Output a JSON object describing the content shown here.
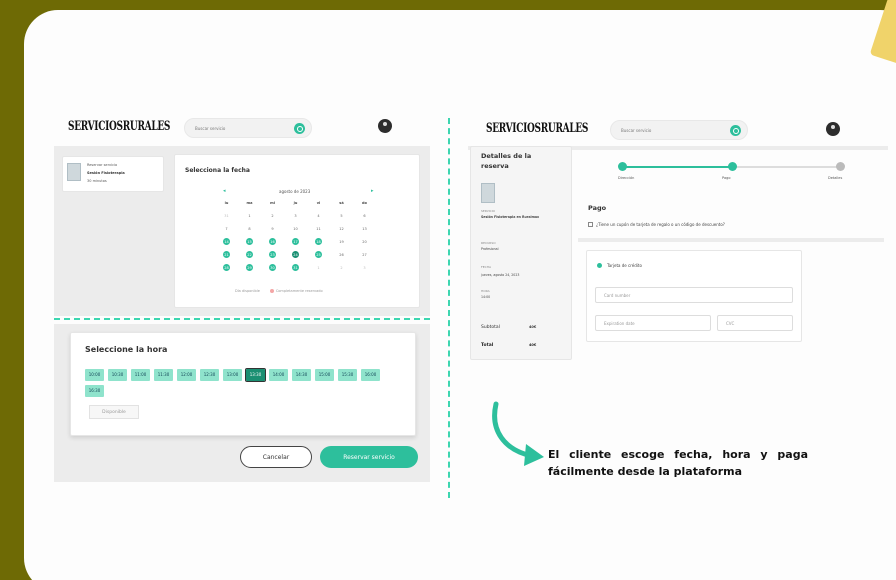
{
  "brand": {
    "logo": "SERVICIOSRURALES"
  },
  "search": {
    "placeholder": "Buscar servicio"
  },
  "colors": {
    "accent": "#2dbf9c",
    "accent_dark": "#1a8f72",
    "background": "#6e6a05"
  },
  "left": {
    "service_card": {
      "label": "Reservar servicio",
      "name": "Sesión Fisioterapia",
      "duration": "30 minutos"
    },
    "calendar": {
      "title": "Selecciona la fecha",
      "month": "agosto de 2023",
      "weekdays": [
        "lu",
        "ma",
        "mi",
        "ju",
        "vi",
        "sá",
        "do"
      ],
      "days": [
        {
          "d": "31",
          "s": "dim"
        },
        {
          "d": "1",
          "s": ""
        },
        {
          "d": "2",
          "s": ""
        },
        {
          "d": "3",
          "s": ""
        },
        {
          "d": "4",
          "s": ""
        },
        {
          "d": "5",
          "s": ""
        },
        {
          "d": "6",
          "s": ""
        },
        {
          "d": "7",
          "s": ""
        },
        {
          "d": "8",
          "s": ""
        },
        {
          "d": "9",
          "s": ""
        },
        {
          "d": "10",
          "s": ""
        },
        {
          "d": "11",
          "s": ""
        },
        {
          "d": "12",
          "s": ""
        },
        {
          "d": "13",
          "s": ""
        },
        {
          "d": "14",
          "s": "av"
        },
        {
          "d": "15",
          "s": "av"
        },
        {
          "d": "16",
          "s": "av"
        },
        {
          "d": "17",
          "s": "av"
        },
        {
          "d": "18",
          "s": "av"
        },
        {
          "d": "19",
          "s": ""
        },
        {
          "d": "20",
          "s": ""
        },
        {
          "d": "21",
          "s": "av"
        },
        {
          "d": "22",
          "s": "av"
        },
        {
          "d": "23",
          "s": "av"
        },
        {
          "d": "24",
          "s": "av sel"
        },
        {
          "d": "25",
          "s": "av"
        },
        {
          "d": "26",
          "s": ""
        },
        {
          "d": "27",
          "s": ""
        },
        {
          "d": "28",
          "s": "av"
        },
        {
          "d": "29",
          "s": "av"
        },
        {
          "d": "30",
          "s": "av"
        },
        {
          "d": "31",
          "s": "av"
        },
        {
          "d": "1",
          "s": "dim"
        },
        {
          "d": "2",
          "s": "dim"
        },
        {
          "d": "3",
          "s": "dim"
        }
      ],
      "legend_available": "Día disponible",
      "legend_full": "Completamente reservado"
    },
    "hours": {
      "title": "Seleccione la hora",
      "slots": [
        "10:00",
        "10:30",
        "11:00",
        "11:30",
        "12:00",
        "12:30",
        "13:00",
        "13:30",
        "14:00",
        "14:30",
        "15:00",
        "15:30",
        "16:00",
        "16:30"
      ],
      "selected": "13:30",
      "legend": "Disponible"
    },
    "buttons": {
      "cancel": "Cancelar",
      "reserve": "Reservar servicio"
    }
  },
  "right": {
    "details": {
      "title": "Detalles de la reserva",
      "service_label": "SERVICIO",
      "service_value": "Sesión Fisioterapia en Ruralmax",
      "resource_label": "RECURSO",
      "resource_value": "Profesional",
      "date_label": "FECHA",
      "date_value": "jueves, agosto 24, 2023",
      "time_label": "HORA",
      "time_value": "14:00",
      "subtotal_label": "Subtotal",
      "subtotal_value": "40€",
      "total_label": "Total",
      "total_value": "40€"
    },
    "steps": [
      "Dirección",
      "Pago",
      "Detalles"
    ],
    "payment": {
      "title": "Pago",
      "coupon": "¿Tiene un cupón de tarjeta de regalo o un código de descuento?",
      "method": "Tarjeta de crédito",
      "card_number": "Card number",
      "expiration": "Expiration date",
      "cvc": "CVC"
    }
  },
  "caption": "El cliente escoge fecha, hora y paga fácilmente desde la plataforma"
}
